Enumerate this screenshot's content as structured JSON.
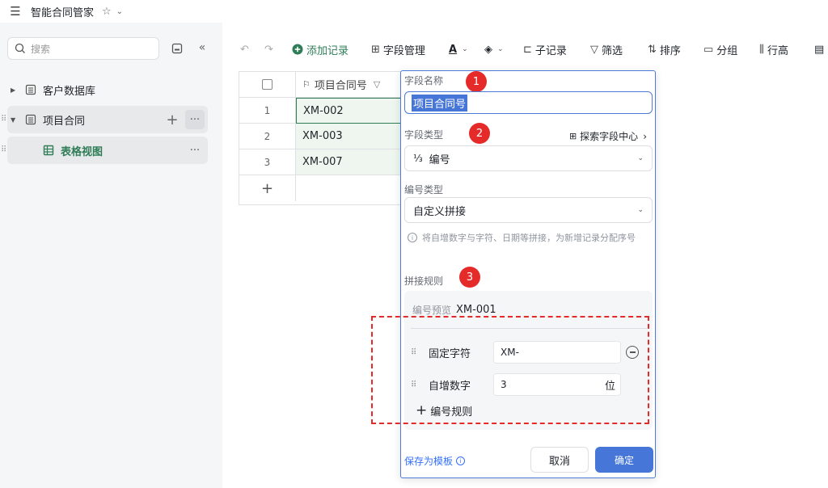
{
  "topbar": {
    "doc_title": "智能合同管家",
    "icons": [
      "menu-icon",
      "star-icon",
      "chevron-down-icon"
    ]
  },
  "sidebar": {
    "search_placeholder": "搜索",
    "items": [
      {
        "label": "客户数据库",
        "expanded": false,
        "icon": "table-icon"
      },
      {
        "label": "项目合同",
        "expanded": true,
        "icon": "table-icon"
      },
      {
        "label": "表格视图",
        "icon": "grid-view-icon",
        "active": true
      }
    ]
  },
  "toolbar": {
    "add_record": "添加记录",
    "field_manage": "字段管理",
    "sub_record": "子记录",
    "filter": "筛选",
    "sort": "排序",
    "group": "分组",
    "row_height": "行高",
    "accent_color": "#2e7d57"
  },
  "grid": {
    "column_header": "项目合同号",
    "rows": [
      {
        "index": "1",
        "value": "XM-002"
      },
      {
        "index": "2",
        "value": "XM-003"
      },
      {
        "index": "3",
        "value": "XM-007"
      }
    ],
    "add_row": "+"
  },
  "panel": {
    "field_name_label": "字段名称",
    "field_name_value": "项目合同号",
    "field_type_label": "字段类型",
    "explore_link": "探索字段中心",
    "field_type_value": "编号",
    "number_type_label": "编号类型",
    "number_type_value": "自定义拼接",
    "hint": "将自增数字与字符、日期等拼接，为新增记录分配序号",
    "rules_label": "拼接规则",
    "preview_label": "编号预览",
    "preview_value": "XM-001",
    "rules": [
      {
        "name": "固定字符",
        "value": "XM-",
        "unit": ""
      },
      {
        "name": "自增数字",
        "value": "3",
        "unit": "位"
      }
    ],
    "add_rule": "编号规则",
    "save_template": "保存为模板",
    "cancel": "取消",
    "confirm": "确定",
    "badges": [
      "1",
      "2",
      "3"
    ],
    "primary_color": "#4677d8",
    "annotation_color": "#e52a2a"
  }
}
